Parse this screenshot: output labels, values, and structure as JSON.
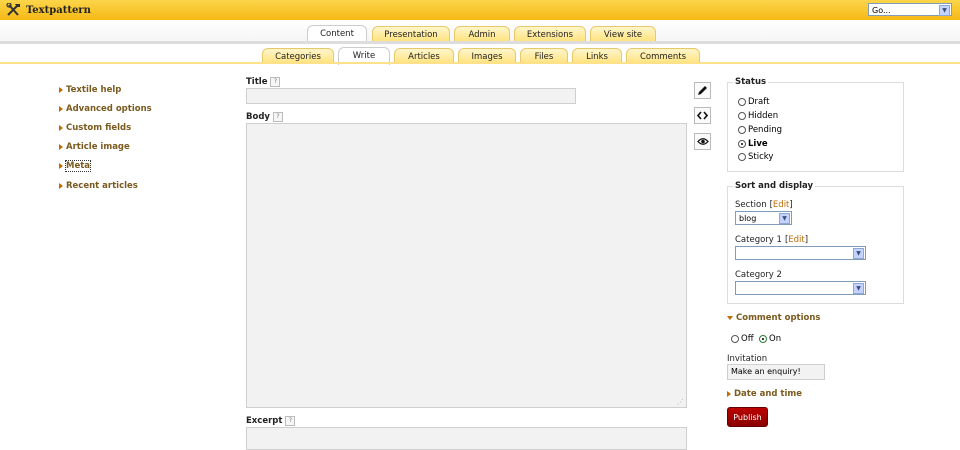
{
  "app": {
    "title": "Textpattern",
    "go_select": "Go..."
  },
  "tabs_primary": [
    {
      "label": "Content"
    },
    {
      "label": "Presentation"
    },
    {
      "label": "Admin"
    },
    {
      "label": "Extensions"
    },
    {
      "label": "View site"
    }
  ],
  "tabs_secondary": [
    {
      "label": "Categories"
    },
    {
      "label": "Write"
    },
    {
      "label": "Articles"
    },
    {
      "label": "Images"
    },
    {
      "label": "Files"
    },
    {
      "label": "Links"
    },
    {
      "label": "Comments"
    }
  ],
  "left_links": [
    {
      "label": "Textile help"
    },
    {
      "label": "Advanced options"
    },
    {
      "label": "Custom fields"
    },
    {
      "label": "Article image"
    },
    {
      "label": "Meta"
    },
    {
      "label": "Recent articles"
    }
  ],
  "fields": {
    "title_label": "Title",
    "body_label": "Body",
    "excerpt_label": "Excerpt",
    "help": "?"
  },
  "status": {
    "legend": "Status",
    "options": [
      {
        "label": "Draft"
      },
      {
        "label": "Hidden"
      },
      {
        "label": "Pending"
      },
      {
        "label": "Live"
      },
      {
        "label": "Sticky"
      }
    ],
    "selected": "Live"
  },
  "sort": {
    "legend": "Sort and display",
    "section_label": "Section",
    "edit": "Edit",
    "section_value": "blog",
    "category1_label": "Category 1",
    "category2_label": "Category 2"
  },
  "comments": {
    "toggle_label": "Comment options",
    "off": "Off",
    "on": "On",
    "invitation_label": "Invitation",
    "invitation_value": "Make an enquiry!"
  },
  "date_time_label": "Date and time",
  "publish_label": "Publish"
}
